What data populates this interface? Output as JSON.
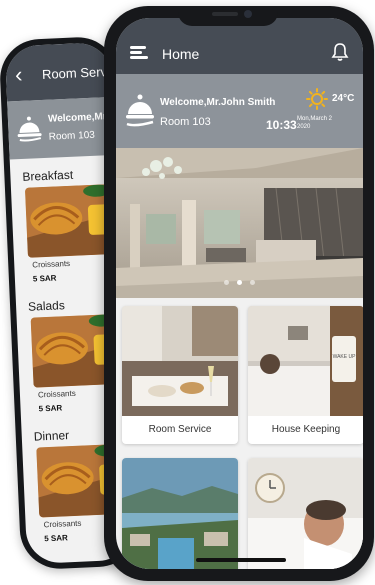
{
  "back_phone": {
    "title": "Room Service",
    "welcome_name": "Welcome,Mr",
    "room": "Room 103",
    "sections": [
      {
        "name": "Breakfast",
        "item_label": "Croissants",
        "price": "5 SAR"
      },
      {
        "name": "Salads",
        "item_label": "Croissants",
        "price": "5 SAR"
      },
      {
        "name": "Dinner",
        "item_label": "Croissants",
        "price": "5 SAR"
      }
    ]
  },
  "front_phone": {
    "header": {
      "title": "Home"
    },
    "welcome": {
      "name": "Welcome,Mr.John Smith",
      "room": "Room 103",
      "temperature": "24°C",
      "time": "10:33",
      "date": "Mon,March 2 2020"
    },
    "carousel": {
      "slide_count": 3,
      "active_index": 1
    },
    "tiles": [
      {
        "label": "Room Service"
      },
      {
        "label": "House Keeping"
      },
      {
        "label": ""
      },
      {
        "label": ""
      }
    ]
  },
  "colors": {
    "header_bg": "#464c55",
    "welcome_bg": "#8d939a",
    "sun": "#f2b31d",
    "phone_body": "#17181b"
  },
  "icons": [
    "menu-icon",
    "bell-icon",
    "service-bell-icon",
    "sun-icon",
    "back-arrow-icon"
  ]
}
